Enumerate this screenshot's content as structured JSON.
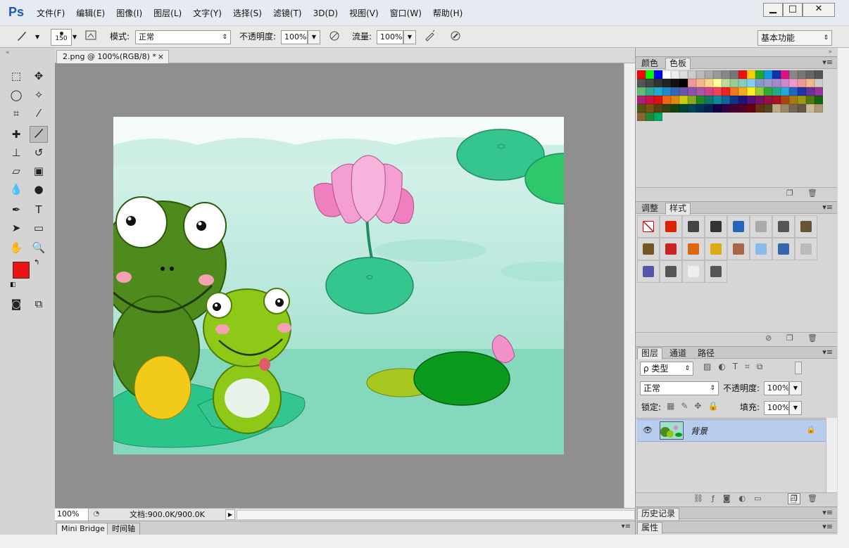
{
  "app": {
    "logo": "Ps"
  },
  "menu": [
    "文件(F)",
    "编辑(E)",
    "图像(I)",
    "图层(L)",
    "文字(Y)",
    "选择(S)",
    "滤镜(T)",
    "3D(D)",
    "视图(V)",
    "窗口(W)",
    "帮助(H)"
  ],
  "window_controls": {
    "minimize": "▁",
    "maximize": "□",
    "close": "✕"
  },
  "options": {
    "brush_size": "150",
    "mode_label": "模式:",
    "mode_value": "正常",
    "opacity_label": "不透明度:",
    "opacity_value": "100%",
    "flow_label": "流量:",
    "flow_value": "100%",
    "workspace": "基本功能"
  },
  "document": {
    "tab_title": "2.png @ 100%(RGB/8) *",
    "close": "×",
    "zoom": "100%",
    "doc_info": "文档:900.0K/900.0K"
  },
  "bottom_tabs": [
    "Mini Bridge",
    "时间轴"
  ],
  "color_panel": {
    "tabs": [
      "颜色",
      "色板"
    ],
    "active": 1
  },
  "swatch_colors": [
    "#ff0000",
    "#00ff00",
    "#0000ff",
    "#ffffff",
    "#eeeeee",
    "#dddddd",
    "#cccccc",
    "#bbbbbb",
    "#aaaaaa",
    "#999999",
    "#888888",
    "#777777",
    "#ee1111",
    "#ffcc00",
    "#22aa22",
    "#1199dd",
    "#1133aa",
    "#dd1188",
    "#888888",
    "#777777",
    "#666666",
    "#555555",
    "#555555",
    "#444444",
    "#333333",
    "#222222",
    "#111111",
    "#000000",
    "#ee9999",
    "#f4b888",
    "#f8d890",
    "#ffff99",
    "#bbdd99",
    "#99cc99",
    "#88ccbb",
    "#88ccee",
    "#8899cc",
    "#9999cc",
    "#aa88cc",
    "#cc88cc",
    "#ee99cc",
    "#ee9999",
    "#f4b888",
    "#cccccc",
    "#66bb77",
    "#33aa88",
    "#22aacc",
    "#2288cc",
    "#3366bb",
    "#6655aa",
    "#8855aa",
    "#aa55aa",
    "#cc4488",
    "#ee4455",
    "#ee2222",
    "#ee7722",
    "#f4aa22",
    "#ffee22",
    "#99cc33",
    "#33aa33",
    "#22aa88",
    "#22aadd",
    "#2266bb",
    "#2233aa",
    "#663399",
    "#993399",
    "#aa2277",
    "#cc1144",
    "#dd1111",
    "#ee6611",
    "#dd8811",
    "#cccc11",
    "#88aa22",
    "#228822",
    "#117766",
    "#118899",
    "#116699",
    "#113388",
    "#221177",
    "#551177",
    "#771166",
    "#991144",
    "#aa1122",
    "#aa4411",
    "#aa7711",
    "#999911",
    "#557711",
    "#116611",
    "#555511",
    "#775511",
    "#554411",
    "#334411",
    "#114411",
    "#004433",
    "#004455",
    "#003355",
    "#002255",
    "#110044",
    "#330044",
    "#440033",
    "#550022",
    "#660011",
    "#663311",
    "#554422",
    "#bbaa88",
    "#998866",
    "#776655",
    "#665544",
    "#ccbb99",
    "#aa9977",
    "#886633",
    "#228833",
    "#00aa66"
  ],
  "style_panel": {
    "tabs": [
      "调整",
      "样式"
    ],
    "active": 1
  },
  "style_colors": [
    "#ffffff",
    "#dd2200",
    "#444444",
    "#333333",
    "#2266bb",
    "#aaaaaa",
    "#555555",
    "#665533",
    "#775522",
    "#cc2222",
    "#dd6611",
    "#ddaa11",
    "#aa6644",
    "#88bbee",
    "#3366aa",
    "#bbbbbb",
    "#5555aa",
    "#555555",
    "#eeeeee",
    "#555555"
  ],
  "layers_panel": {
    "tabs": [
      "图层",
      "通道",
      "路径"
    ],
    "active": 0,
    "filter_label": "ρ 类型",
    "blend_mode": "正常",
    "opacity_label": "不透明度:",
    "opacity_value": "100%",
    "lock_label": "锁定:",
    "fill_label": "填充:",
    "fill_value": "100%",
    "layer_name": "背景"
  },
  "history_panel": {
    "title": "历史记录"
  },
  "properties_panel": {
    "title": "属性"
  },
  "colors": {
    "foreground": "#ee1111",
    "background": "#ffffff",
    "accent": "#1c5ab0",
    "layer_selected": "#b8ccee"
  }
}
